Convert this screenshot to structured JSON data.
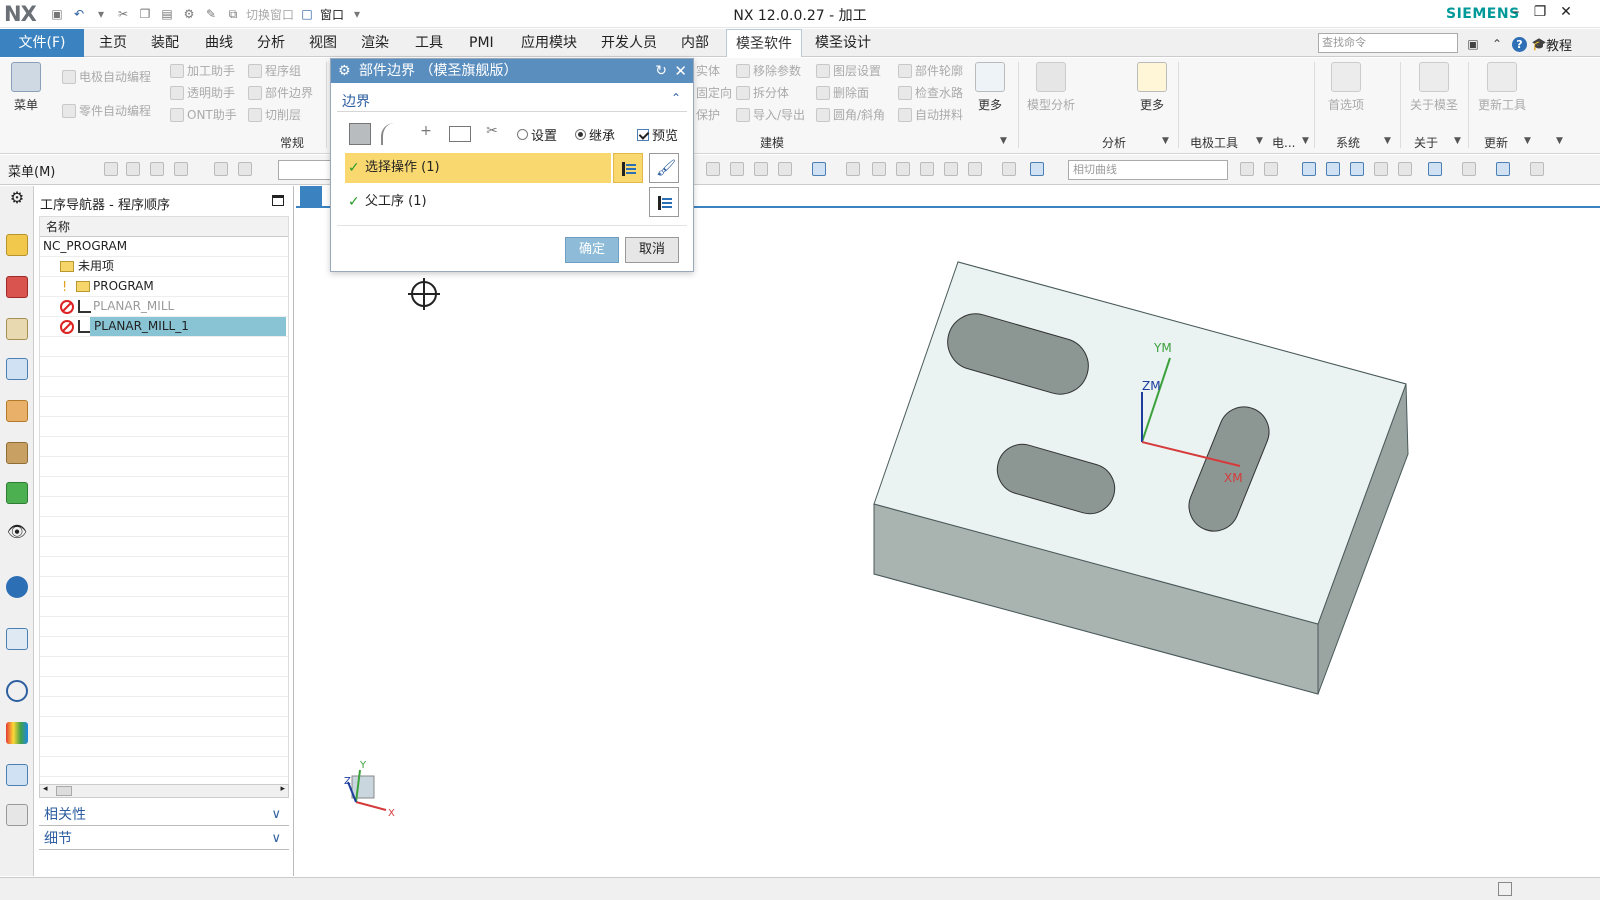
{
  "app": {
    "logo": "NX",
    "window_title": "NX 12.0.0.27 - 加工",
    "brand": "SIEMENS",
    "brand_color": "#009999",
    "accent": "#3b83c0"
  },
  "quick_access": {
    "switch_window": "切换窗口",
    "window": "窗口"
  },
  "menubar": {
    "file": "文件(F)",
    "tabs": [
      "主页",
      "装配",
      "曲线",
      "分析",
      "视图",
      "渲染",
      "工具",
      "PMI",
      "应用模块",
      "开发人员",
      "内部",
      "模圣软件",
      "模圣设计"
    ],
    "active_tab": "模圣软件",
    "search_placeholder": "查找命令",
    "tutorial": "教程"
  },
  "ribbon": {
    "menu_label": "菜单",
    "small_items": [
      "电极自动编程",
      "零件自动编程",
      "加工助手",
      "透明助手",
      "ONT助手",
      "程序组",
      "部件边界",
      "切削层"
    ],
    "right_items": [
      "移除参数",
      "拆分体",
      "导入/导出",
      "图层设置",
      "删除面",
      "圆角/斜角",
      "部件轮廓",
      "检查水路",
      "自动拼料"
    ],
    "partial_items": [
      "实体",
      "固定向",
      "保护"
    ],
    "more": "更多",
    "model_analysis": "模型分析",
    "preferences": "首选项",
    "about": "关于模圣",
    "update_tool": "更新工具",
    "groups": [
      "常规",
      "建模",
      "分析",
      "电极工具",
      "电...",
      "系统",
      "关于",
      "更新"
    ]
  },
  "toolbar2": {
    "menu": "菜单(M)",
    "curve_combo": "相切曲线"
  },
  "navigator": {
    "title": "工序导航器 - 程序顺序",
    "column_name": "名称",
    "rows": [
      {
        "label": "NC_PROGRAM"
      },
      {
        "label": "未用项"
      },
      {
        "label": "PROGRAM"
      },
      {
        "label": "PLANAR_MILL"
      },
      {
        "label": "PLANAR_MILL_1"
      }
    ],
    "accordions": [
      "相关性",
      "细节"
    ]
  },
  "dialog": {
    "title": "部件边界 （模圣旗舰版）",
    "section": "边界",
    "radio_setting": "设置",
    "radio_inherit": "继承",
    "radio_selected": "继承",
    "preview": "预览",
    "preview_checked": true,
    "row1": "选择操作 (1)",
    "row2": "父工序 (1)",
    "ok": "确定",
    "cancel": "取消"
  },
  "model": {
    "axis_ym": "YM",
    "axis_zm": "ZM",
    "axis_xm": "XM",
    "triad_y": "Y",
    "triad_x": "X",
    "triad_z": "Z"
  }
}
